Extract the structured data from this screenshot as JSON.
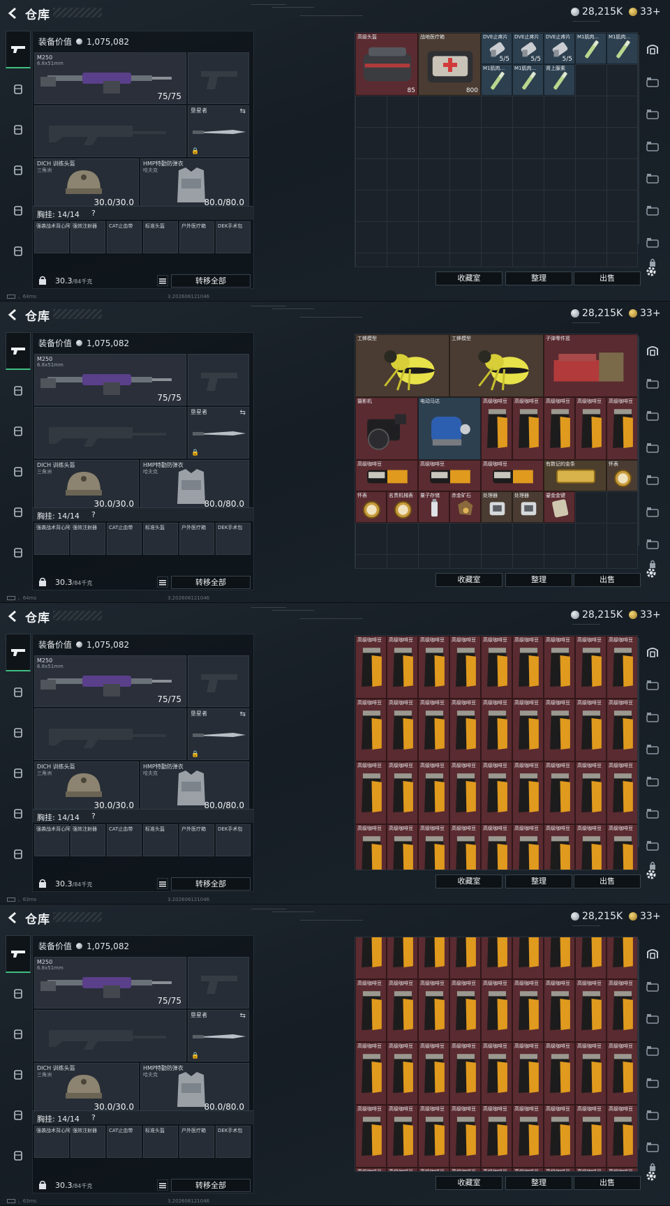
{
  "header": {
    "title": "仓库",
    "currency_silver": "28,215K",
    "currency_gold": "33+"
  },
  "loadout": {
    "equip_value_label": "装备价值",
    "equip_value": "1,075,082",
    "primary": {
      "name": "M250",
      "caliber": "6.8x51mm",
      "ammo": "75/75"
    },
    "knife": {
      "name": "垦星者"
    },
    "helmet": {
      "name": "DICH 训练头盔",
      "sub": "三角洲",
      "durability": "30.0/30.0"
    },
    "armor": {
      "name": "HMP特勤防弹衣",
      "sub": "哈夫克",
      "durability": "80.0/80.0"
    },
    "rig_label": "胸挂: 14/14",
    "rig_help": "?",
    "rig_slots": [
      "强袭战术背心阿萨拉",
      "强效注射器",
      "CAT止血带",
      "标准头盔",
      "户外医疗箱",
      "DEK手术包"
    ],
    "weight": "30.3",
    "weight_unit": "/84千克",
    "transfer_all": "转移全部"
  },
  "stash_buttons": {
    "collection": "收藏室",
    "sort": "整理",
    "sell": "出售"
  },
  "footer": {
    "ping1": "64ms",
    "ping2": "64ms",
    "ping3": "63ms",
    "ping4": "63ms",
    "build": "3.202606121046"
  },
  "panels": [
    {
      "items": [
        {
          "label": "高级头盔",
          "col": 0,
          "row": 0,
          "w": 2,
          "h": 2,
          "color": "red",
          "icon": "helmet-bag",
          "count": "85"
        },
        {
          "label": "战地医疗箱",
          "col": 2,
          "row": 0,
          "w": 2,
          "h": 2,
          "color": "brown",
          "icon": "medkit",
          "count": "800"
        },
        {
          "label": "DVE止疼片",
          "col": 4,
          "row": 0,
          "w": 1,
          "h": 1,
          "color": "blue",
          "icon": "pill",
          "count": "5/5"
        },
        {
          "label": "DVE止疼片",
          "col": 5,
          "row": 0,
          "w": 1,
          "h": 1,
          "color": "blue",
          "icon": "pill",
          "count": "5/5"
        },
        {
          "label": "DVE止疼片",
          "col": 6,
          "row": 0,
          "w": 1,
          "h": 1,
          "color": "blue",
          "icon": "pill",
          "count": "5/5"
        },
        {
          "label": "M1肌肉...",
          "col": 7,
          "row": 0,
          "w": 1,
          "h": 1,
          "color": "blue",
          "icon": "syringe",
          "count": ""
        },
        {
          "label": "M1肌肉...",
          "col": 8,
          "row": 0,
          "w": 1,
          "h": 1,
          "color": "blue",
          "icon": "syringe",
          "count": ""
        },
        {
          "label": "M1肌肉...",
          "col": 4,
          "row": 1,
          "w": 1,
          "h": 1,
          "color": "blue",
          "icon": "syringe",
          "count": ""
        },
        {
          "label": "M1肌肉...",
          "col": 5,
          "row": 1,
          "w": 1,
          "h": 1,
          "color": "blue",
          "icon": "syringe",
          "count": ""
        },
        {
          "label": "肾上腺素",
          "col": 6,
          "row": 1,
          "w": 1,
          "h": 1,
          "color": "blue",
          "icon": "syringe",
          "count": ""
        }
      ]
    },
    {
      "items": [
        {
          "label": "工蜂模型",
          "col": 0,
          "row": 0,
          "w": 3,
          "h": 2,
          "color": "brown",
          "icon": "wasp",
          "count": ""
        },
        {
          "label": "工蜂模型",
          "col": 3,
          "row": 0,
          "w": 3,
          "h": 2,
          "color": "brown",
          "icon": "wasp",
          "count": ""
        },
        {
          "label": "子弹零件篮",
          "col": 6,
          "row": 0,
          "w": 3,
          "h": 2,
          "color": "red",
          "icon": "crate",
          "count": ""
        },
        {
          "label": "摄影机",
          "col": 0,
          "row": 2,
          "w": 2,
          "h": 2,
          "color": "red",
          "icon": "camera",
          "count": ""
        },
        {
          "label": "电动马达",
          "col": 2,
          "row": 2,
          "w": 2,
          "h": 2,
          "color": "blue",
          "icon": "motor",
          "count": ""
        },
        {
          "label": "高级咖啡豆",
          "col": 4,
          "row": 2,
          "w": 1,
          "h": 2,
          "color": "red",
          "icon": "coffee",
          "count": ""
        },
        {
          "label": "高级咖啡豆",
          "col": 5,
          "row": 2,
          "w": 1,
          "h": 2,
          "color": "red",
          "icon": "coffee",
          "count": ""
        },
        {
          "label": "高级咖啡豆",
          "col": 6,
          "row": 2,
          "w": 1,
          "h": 2,
          "color": "red",
          "icon": "coffee",
          "count": ""
        },
        {
          "label": "高级咖啡豆",
          "col": 7,
          "row": 2,
          "w": 1,
          "h": 2,
          "color": "red",
          "icon": "coffee",
          "count": ""
        },
        {
          "label": "高级咖啡豆",
          "col": 8,
          "row": 2,
          "w": 1,
          "h": 2,
          "color": "red",
          "icon": "coffee",
          "count": ""
        },
        {
          "label": "高级咖啡豆",
          "col": 0,
          "row": 4,
          "w": 2,
          "h": 1,
          "color": "red",
          "icon": "coffee-flat",
          "count": ""
        },
        {
          "label": "高级咖啡豆",
          "col": 2,
          "row": 4,
          "w": 2,
          "h": 1,
          "color": "red",
          "icon": "coffee-flat",
          "count": ""
        },
        {
          "label": "高级咖啡豆",
          "col": 4,
          "row": 4,
          "w": 2,
          "h": 1,
          "color": "red",
          "icon": "coffee-flat",
          "count": ""
        },
        {
          "label": "有数记的金条",
          "col": 6,
          "row": 4,
          "w": 2,
          "h": 1,
          "color": "gold",
          "icon": "goldbar",
          "count": ""
        },
        {
          "label": "怀表",
          "col": 8,
          "row": 4,
          "w": 1,
          "h": 1,
          "color": "brown",
          "icon": "watch",
          "count": ""
        },
        {
          "label": "怀表",
          "col": 0,
          "row": 5,
          "w": 1,
          "h": 1,
          "color": "red",
          "icon": "watch",
          "count": ""
        },
        {
          "label": "名贵机械表",
          "col": 1,
          "row": 5,
          "w": 1,
          "h": 1,
          "color": "red",
          "icon": "watch",
          "count": ""
        },
        {
          "label": "量子存储",
          "col": 2,
          "row": 5,
          "w": 1,
          "h": 1,
          "color": "red",
          "icon": "usb",
          "count": ""
        },
        {
          "label": "赤金矿石",
          "col": 3,
          "row": 5,
          "w": 1,
          "h": 1,
          "color": "red",
          "icon": "ore",
          "count": ""
        },
        {
          "label": "处理器",
          "col": 4,
          "row": 5,
          "w": 1,
          "h": 1,
          "color": "brown",
          "icon": "chip",
          "count": ""
        },
        {
          "label": "处理器",
          "col": 5,
          "row": 5,
          "w": 1,
          "h": 1,
          "color": "brown",
          "icon": "chip",
          "count": ""
        },
        {
          "label": "鎏金金键",
          "col": 6,
          "row": 5,
          "w": 1,
          "h": 1,
          "color": "red",
          "icon": "card",
          "count": ""
        }
      ]
    },
    {
      "coffee_grid": true,
      "label": "高级咖啡豆",
      "rows_offset": 0
    },
    {
      "coffee_grid": true,
      "label": "高级咖啡豆",
      "rows_offset": 1
    }
  ]
}
